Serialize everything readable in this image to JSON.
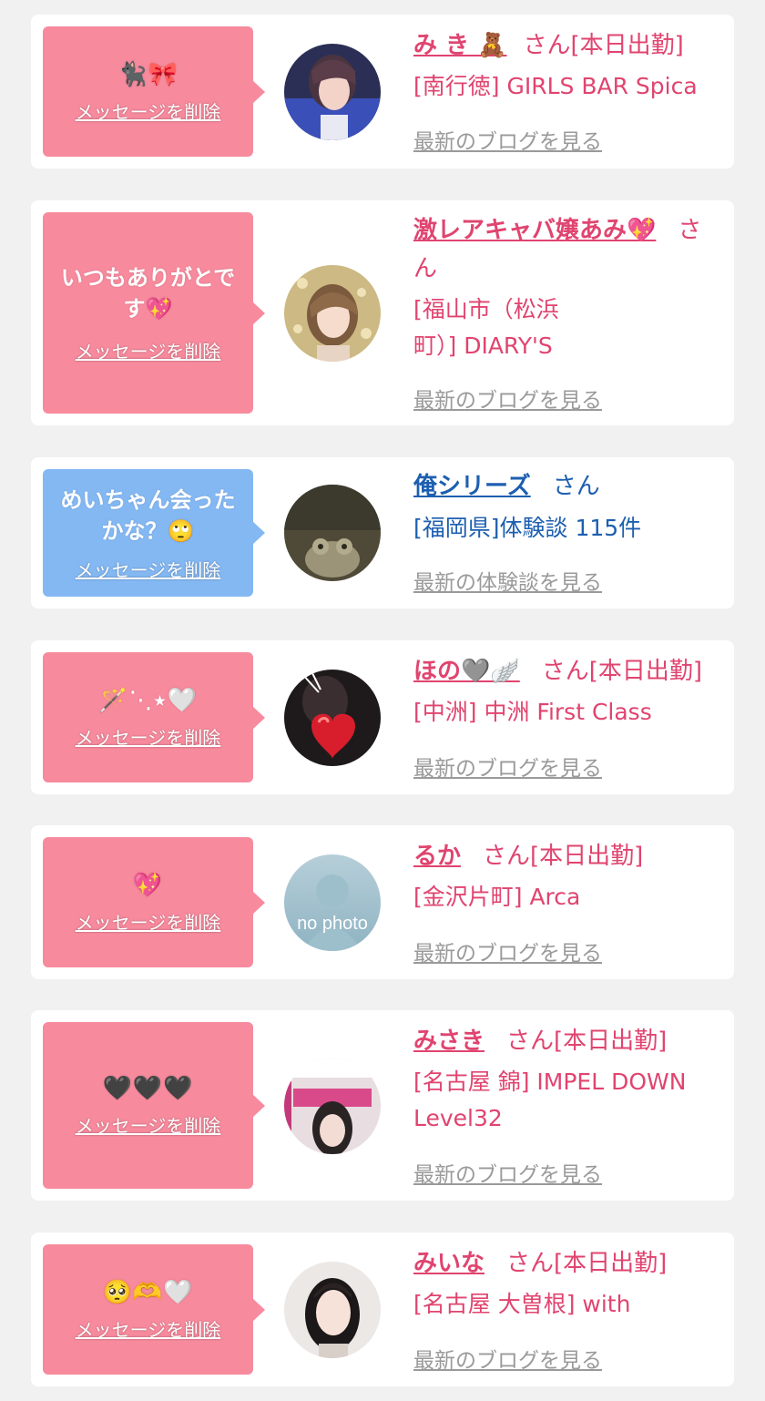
{
  "colors": {
    "background": "#f1f1f1",
    "card": "#ffffff",
    "bubble_pink": "#f78a9d",
    "bubble_blue": "#84b8f3",
    "name_pink": "#e0446f",
    "name_blue": "#1d5fb0",
    "link_gray": "#9a9a9a"
  },
  "items": [
    {
      "message": "🐈‍⬛🎀",
      "delete_label": "メッセージを削除",
      "name": "み き 🧸",
      "honorific": "さん",
      "status": "[本日出勤]",
      "shop": "[南行徳] GIRLS BAR Spica",
      "latest_link": "最新のブログを見る"
    },
    {
      "message": "いつもありがとです💖",
      "delete_label": "メッセージを削除",
      "name": "激レアキャバ嬢あみ💖",
      "honorific": "さん",
      "status": "",
      "shop": "[福山市（松浜町）] DIARY'S",
      "latest_link": "最新のブログを見る"
    },
    {
      "message": "めいちゃん会ったかな？🙄",
      "delete_label": "メッセージを削除",
      "name": "俺シリーズ",
      "honorific": "さん",
      "status": "",
      "shop": "[福岡県]体験談 115件",
      "latest_link": "最新の体験談を見る"
    },
    {
      "message": "🪄⋱⭑🤍",
      "delete_label": "メッセージを削除",
      "name": "ほの🩶🪽",
      "honorific": "さん",
      "status": "[本日出勤]",
      "shop": "[中洲] 中洲 First Class",
      "latest_link": "最新のブログを見る"
    },
    {
      "message": "💖",
      "delete_label": "メッセージを削除",
      "name": "るか",
      "honorific": "さん",
      "status": "[本日出勤]",
      "shop": "[金沢片町] Arca",
      "latest_link": "最新のブログを見る",
      "avatar_text": "no photo"
    },
    {
      "message": "🖤🖤🖤",
      "delete_label": "メッセージを削除",
      "name": "みさき",
      "honorific": "さん",
      "status": "[本日出勤]",
      "shop": "[名古屋 錦] IMPEL DOWN Level32",
      "latest_link": "最新のブログを見る"
    },
    {
      "message": "🥺🫶🤍",
      "delete_label": "メッセージを削除",
      "name": "みいな",
      "honorific": "さん",
      "status": "[本日出勤]",
      "shop": "[名古屋 大曽根] with",
      "latest_link": "最新のブログを見る"
    }
  ]
}
